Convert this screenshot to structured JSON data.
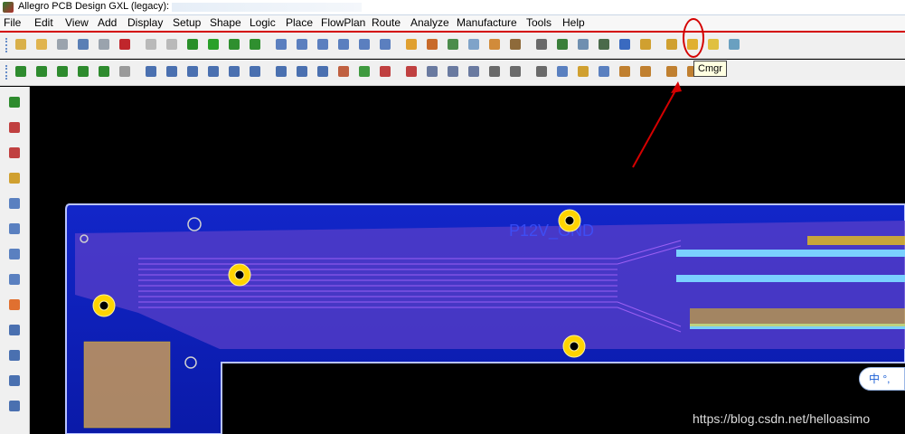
{
  "window": {
    "title": "Allegro PCB Design GXL (legacy):"
  },
  "menubar": {
    "items": [
      "File",
      "Edit",
      "View",
      "Add",
      "Display",
      "Setup",
      "Shape",
      "Logic",
      "Place",
      "FlowPlan",
      "Route",
      "Analyze",
      "Manufacture",
      "Tools",
      "Help"
    ]
  },
  "toolbar1": {
    "buttons": [
      {
        "name": "new-icon",
        "color": "#d9b04a"
      },
      {
        "name": "open-icon",
        "color": "#e0b44f"
      },
      {
        "name": "save-icon",
        "color": "#9aa3ad"
      },
      {
        "name": "move-icon",
        "color": "#5a7fb5"
      },
      {
        "name": "copy-icon",
        "color": "#9aa3ad"
      },
      {
        "name": "delete-icon",
        "color": "#c0262c"
      },
      {
        "name": "undo-icon",
        "color": "#b9b9b9"
      },
      {
        "name": "redo-icon",
        "color": "#b9b9b9"
      },
      {
        "name": "ratsnest-icon",
        "color": "#2a8f2a"
      },
      {
        "name": "pin-icon",
        "color": "#2aa02a"
      },
      {
        "name": "grid-icon",
        "color": "#2f8f2f"
      },
      {
        "name": "layers-icon",
        "color": "#2f8f2f"
      },
      {
        "name": "zoom-points-icon",
        "color": "#5b7fbf"
      },
      {
        "name": "zoom-fit-icon",
        "color": "#5b7fbf"
      },
      {
        "name": "zoom-in-icon",
        "color": "#5b7fbf"
      },
      {
        "name": "zoom-out-icon",
        "color": "#5b7fbf"
      },
      {
        "name": "zoom-prev-icon",
        "color": "#5b7fbf"
      },
      {
        "name": "zoom-world-icon",
        "color": "#5b7fbf"
      },
      {
        "name": "redraw-icon",
        "color": "#e0a030"
      },
      {
        "name": "3d-view-icon",
        "color": "#c86a2a"
      },
      {
        "name": "step-icon",
        "color": "#4c8c4c"
      },
      {
        "name": "grid-toggle-icon",
        "color": "#7fa3c9"
      },
      {
        "name": "color-icon",
        "color": "#d18b3a"
      },
      {
        "name": "shadow-icon",
        "color": "#8e6a3a"
      },
      {
        "name": "stack-icon",
        "color": "#6a6a6a"
      },
      {
        "name": "cmgr-icon",
        "color": "#3a7f3a"
      },
      {
        "name": "spreadsheet-icon",
        "color": "#6f8fb0"
      },
      {
        "name": "board-icon",
        "color": "#4a6a4a"
      },
      {
        "name": "info-icon",
        "color": "#3a6ac0"
      },
      {
        "name": "properties-icon",
        "color": "#d0a030"
      },
      {
        "name": "number-icon",
        "color": "#d0a030"
      },
      {
        "name": "highlight-icon",
        "color": "#e0b030"
      },
      {
        "name": "light-icon",
        "color": "#e0c040"
      },
      {
        "name": "dehighlight-icon",
        "color": "#6aa0c0"
      }
    ]
  },
  "toolbar2": {
    "buttons": [
      {
        "name": "pcb-green-1-icon",
        "color": "#2e8b2e"
      },
      {
        "name": "pcb-green-2-icon",
        "color": "#2e8b2e"
      },
      {
        "name": "pcb-green-3-icon",
        "color": "#2e8b2e"
      },
      {
        "name": "pcb-green-4-icon",
        "color": "#2e8b2e"
      },
      {
        "name": "pcb-green-5-icon",
        "color": "#2e8b2e"
      },
      {
        "name": "pcb-gray-icon",
        "color": "#9a9a9a"
      },
      {
        "name": "shape-l-icon",
        "color": "#4a70b0"
      },
      {
        "name": "rect-shape-icon",
        "color": "#4a70b0"
      },
      {
        "name": "circle-shape-icon",
        "color": "#4a70b0"
      },
      {
        "name": "select-shape-icon",
        "color": "#4a70b0"
      },
      {
        "name": "edit-shape-icon",
        "color": "#4a70b0"
      },
      {
        "name": "void-shape-icon",
        "color": "#4a70b0"
      },
      {
        "name": "void-rect-icon",
        "color": "#4a70b0"
      },
      {
        "name": "void-circle-icon",
        "color": "#4a70b0"
      },
      {
        "name": "merge-shape-icon",
        "color": "#4a70b0"
      },
      {
        "name": "fill-icon",
        "color": "#c06040"
      },
      {
        "name": "place-icon",
        "color": "#3f9a3f"
      },
      {
        "name": "dimension-icon",
        "color": "#c04040"
      },
      {
        "name": "measure-icon",
        "color": "#c04040"
      },
      {
        "name": "odb-icon",
        "color": "#6a7aa0"
      },
      {
        "name": "package-icon",
        "color": "#6a7aa0"
      },
      {
        "name": "symbol-icon",
        "color": "#6a7aa0"
      },
      {
        "name": "camera-icon",
        "color": "#6a6a6a"
      },
      {
        "name": "via-icon",
        "color": "#6a6a6a"
      },
      {
        "name": "text-icon",
        "color": "#6a6a6a"
      },
      {
        "name": "grid-snap-icon",
        "color": "#5a80c0"
      },
      {
        "name": "drc-icon",
        "color": "#d0a030"
      },
      {
        "name": "route-icon",
        "color": "#5a80c0"
      },
      {
        "name": "slide-icon",
        "color": "#c08030"
      },
      {
        "name": "fanout-icon",
        "color": "#c08030"
      },
      {
        "name": "spread-icon",
        "color": "#c08030"
      },
      {
        "name": "gloss-icon",
        "color": "#c08030"
      },
      {
        "name": "tune-icon",
        "color": "#c08030"
      }
    ]
  },
  "left_toolbar": {
    "buttons": [
      {
        "name": "place-manual-icon",
        "color": "#2e8b2e"
      },
      {
        "name": "swap-icon",
        "color": "#c04040"
      },
      {
        "name": "connect-icon",
        "color": "#c04040"
      },
      {
        "name": "add-connect-icon",
        "color": "#d0a030"
      },
      {
        "name": "slide-route-icon",
        "color": "#5a80c0"
      },
      {
        "name": "delay-tune-icon",
        "color": "#5a80c0"
      },
      {
        "name": "custom-smooth-icon",
        "color": "#5a80c0"
      },
      {
        "name": "vertex-icon",
        "color": "#5a80c0"
      },
      {
        "name": "bus-icon",
        "color": "#e07030"
      },
      {
        "name": "auto-route-icon",
        "color": "#4a70b0"
      },
      {
        "name": "spline-icon",
        "color": "#4a70b0"
      },
      {
        "name": "line-icon",
        "color": "#4a70b0"
      },
      {
        "name": "rect-icon",
        "color": "#4a70b0"
      }
    ]
  },
  "tooltip": {
    "text": "Cmgr"
  },
  "canvas": {
    "board_label": "P12V_GND",
    "colors": {
      "copper": "#1b2bd6",
      "outline": "#b8c3ff",
      "trace": "#a64ad6",
      "pad": "#ffd400"
    }
  },
  "ime": {
    "text": "中 °,"
  },
  "watermark": {
    "text": "https://blog.csdn.net/helloasimo"
  }
}
